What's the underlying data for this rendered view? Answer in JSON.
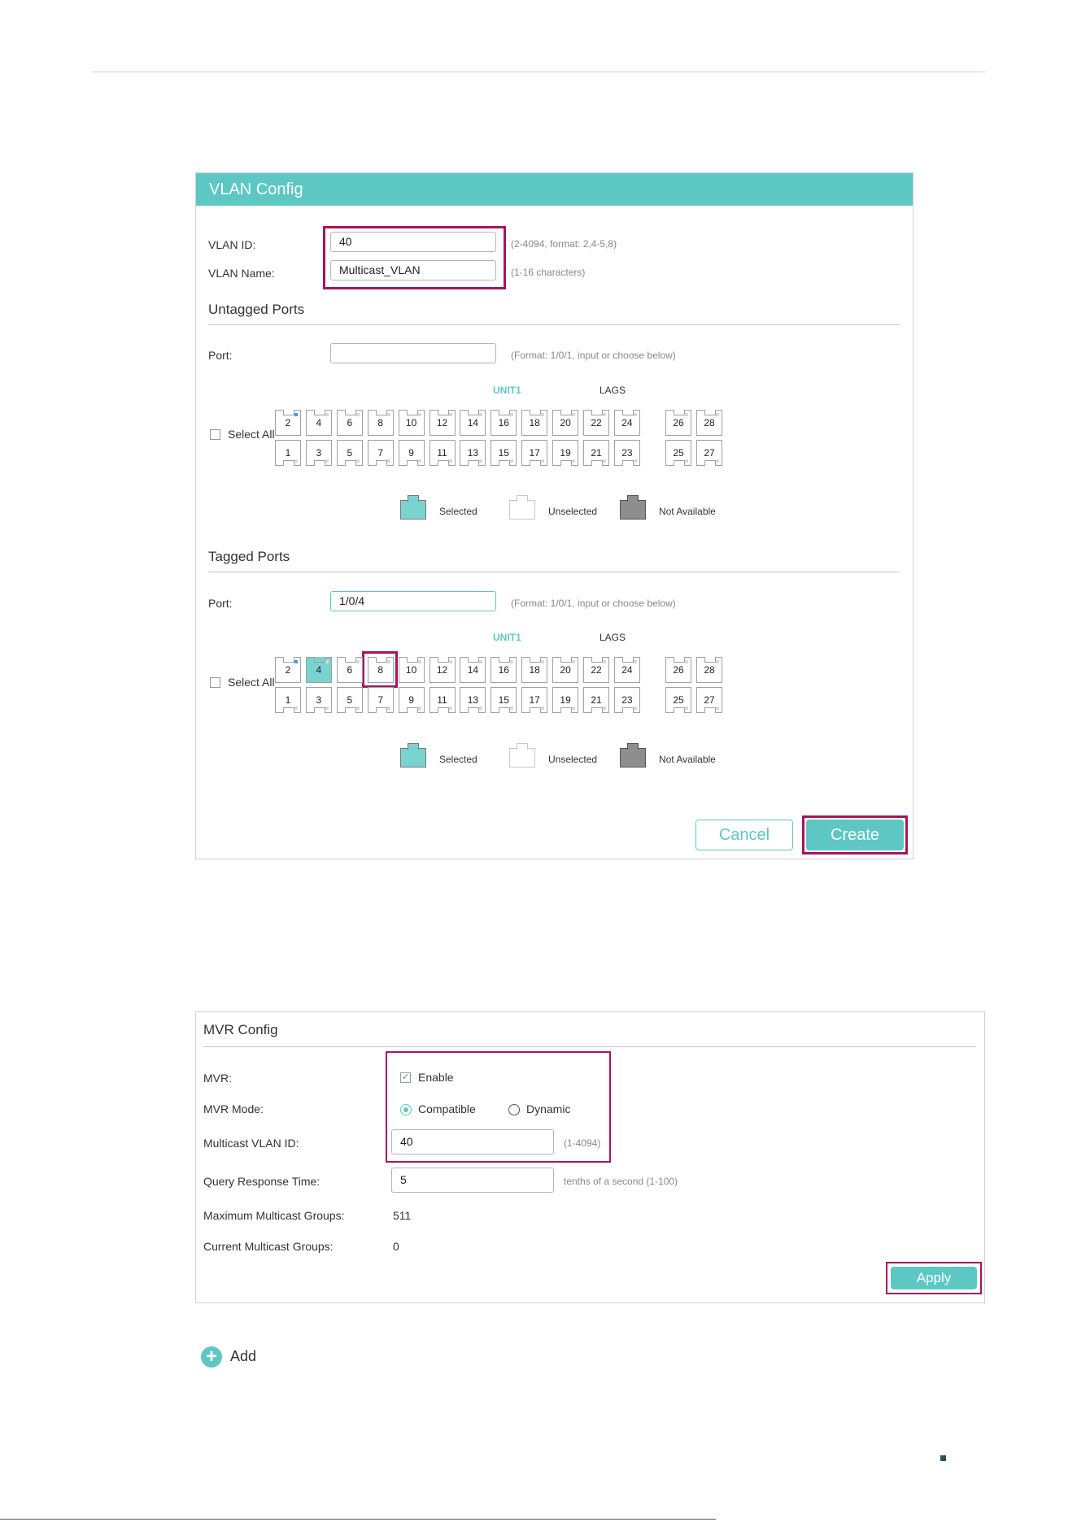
{
  "vlan_config": {
    "title": "VLAN Config",
    "vlan_id_label": "VLAN ID:",
    "vlan_id_value": "40",
    "vlan_id_hint": "(2-4094, format: 2,4-5,8)",
    "vlan_name_label": "VLAN Name:",
    "vlan_name_value": "Multicast_VLAN",
    "vlan_name_hint": "(1-16 characters)",
    "untagged": {
      "title": "Untagged Ports",
      "port_label": "Port:",
      "port_value": "",
      "port_hint": "(Format: 1/0/1, input or choose below)",
      "unit_label": "UNIT1",
      "lags_label": "LAGS",
      "select_all": "Select All",
      "selected_ports": []
    },
    "tagged": {
      "title": "Tagged Ports",
      "port_label": "Port:",
      "port_value": "1/0/4",
      "port_hint": "(Format: 1/0/1, input or choose below)",
      "unit_label": "UNIT1",
      "lags_label": "LAGS",
      "select_all": "Select All",
      "selected_ports": [
        "4"
      ]
    },
    "ports_top": [
      "2",
      "4",
      "6",
      "8",
      "10",
      "12",
      "14",
      "16",
      "18",
      "20",
      "22",
      "24",
      "26",
      "28"
    ],
    "ports_bottom": [
      "1",
      "3",
      "5",
      "7",
      "9",
      "11",
      "13",
      "15",
      "17",
      "19",
      "21",
      "23",
      "25",
      "27"
    ],
    "legend": {
      "selected": "Selected",
      "unselected": "Unselected",
      "not_available": "Not Available"
    },
    "cancel_label": "Cancel",
    "create_label": "Create"
  },
  "mvr_config": {
    "title": "MVR Config",
    "mvr_label": "MVR:",
    "enable_label": "Enable",
    "mode_label": "MVR Mode:",
    "mode_compatible": "Compatible",
    "mode_dynamic": "Dynamic",
    "mcast_vlan_label": "Multicast VLAN ID:",
    "mcast_vlan_value": "40",
    "mcast_vlan_hint": "(1-4094)",
    "query_label": "Query Response Time:",
    "query_value": "5",
    "query_hint": "tenths of a second (1-100)",
    "max_groups_label": "Maximum Multicast Groups:",
    "max_groups_value": "511",
    "current_groups_label": "Current Multicast Groups:",
    "current_groups_value": "0",
    "apply_label": "Apply"
  },
  "add_label": "Add",
  "colors": {
    "accent": "#5dc8c3",
    "highlight": "#a8135f"
  }
}
